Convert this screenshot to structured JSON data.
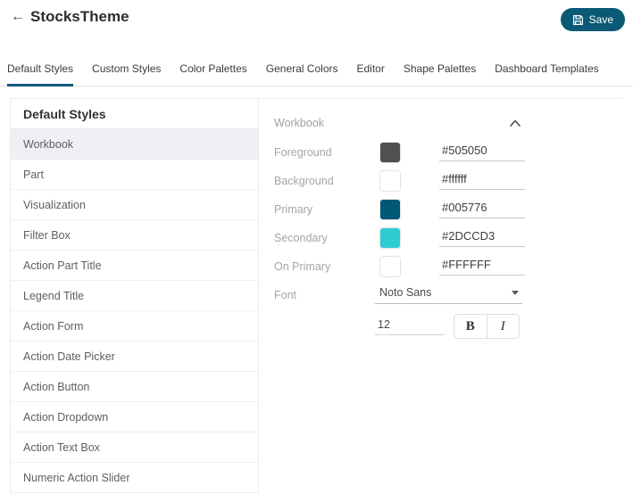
{
  "header": {
    "title": "StocksTheme",
    "save_label": "Save"
  },
  "tabs": [
    {
      "label": "Default Styles",
      "active": true
    },
    {
      "label": "Custom Styles",
      "active": false
    },
    {
      "label": "Color Palettes",
      "active": false
    },
    {
      "label": "General Colors",
      "active": false
    },
    {
      "label": "Editor",
      "active": false
    },
    {
      "label": "Shape Palettes",
      "active": false
    },
    {
      "label": "Dashboard Templates",
      "active": false
    }
  ],
  "left_panel": {
    "heading": "Default Styles",
    "selected_item": "Workbook",
    "items": [
      "Workbook",
      "Part",
      "Visualization",
      "Filter Box",
      "Action Part Title",
      "Legend Title",
      "Action Form",
      "Action Date Picker",
      "Action Button",
      "Action Dropdown",
      "Action Text Box",
      "Numeric Action Slider"
    ]
  },
  "right_panel": {
    "section_title": "Workbook",
    "color_fields": [
      {
        "label": "Foreground",
        "swatch": "#505050",
        "value": "#505050"
      },
      {
        "label": "Background",
        "swatch": "#ffffff",
        "value": "#ffffff"
      },
      {
        "label": "Primary",
        "swatch": "#005776",
        "value": "#005776"
      },
      {
        "label": "Secondary",
        "swatch": "#2DCCD3",
        "value": "#2DCCD3"
      },
      {
        "label": "On Primary",
        "swatch": "#FFFFFF",
        "value": "#FFFFFF"
      }
    ],
    "font_field": {
      "label": "Font",
      "value": "Noto Sans"
    },
    "font_size": {
      "value": "12"
    },
    "bold_label": "B",
    "italic_label": "I"
  },
  "colors": {
    "accent_teal": "#0a5a76",
    "active_tab_underline": "#11587a",
    "selected_row_bg": "#eef0f5"
  }
}
